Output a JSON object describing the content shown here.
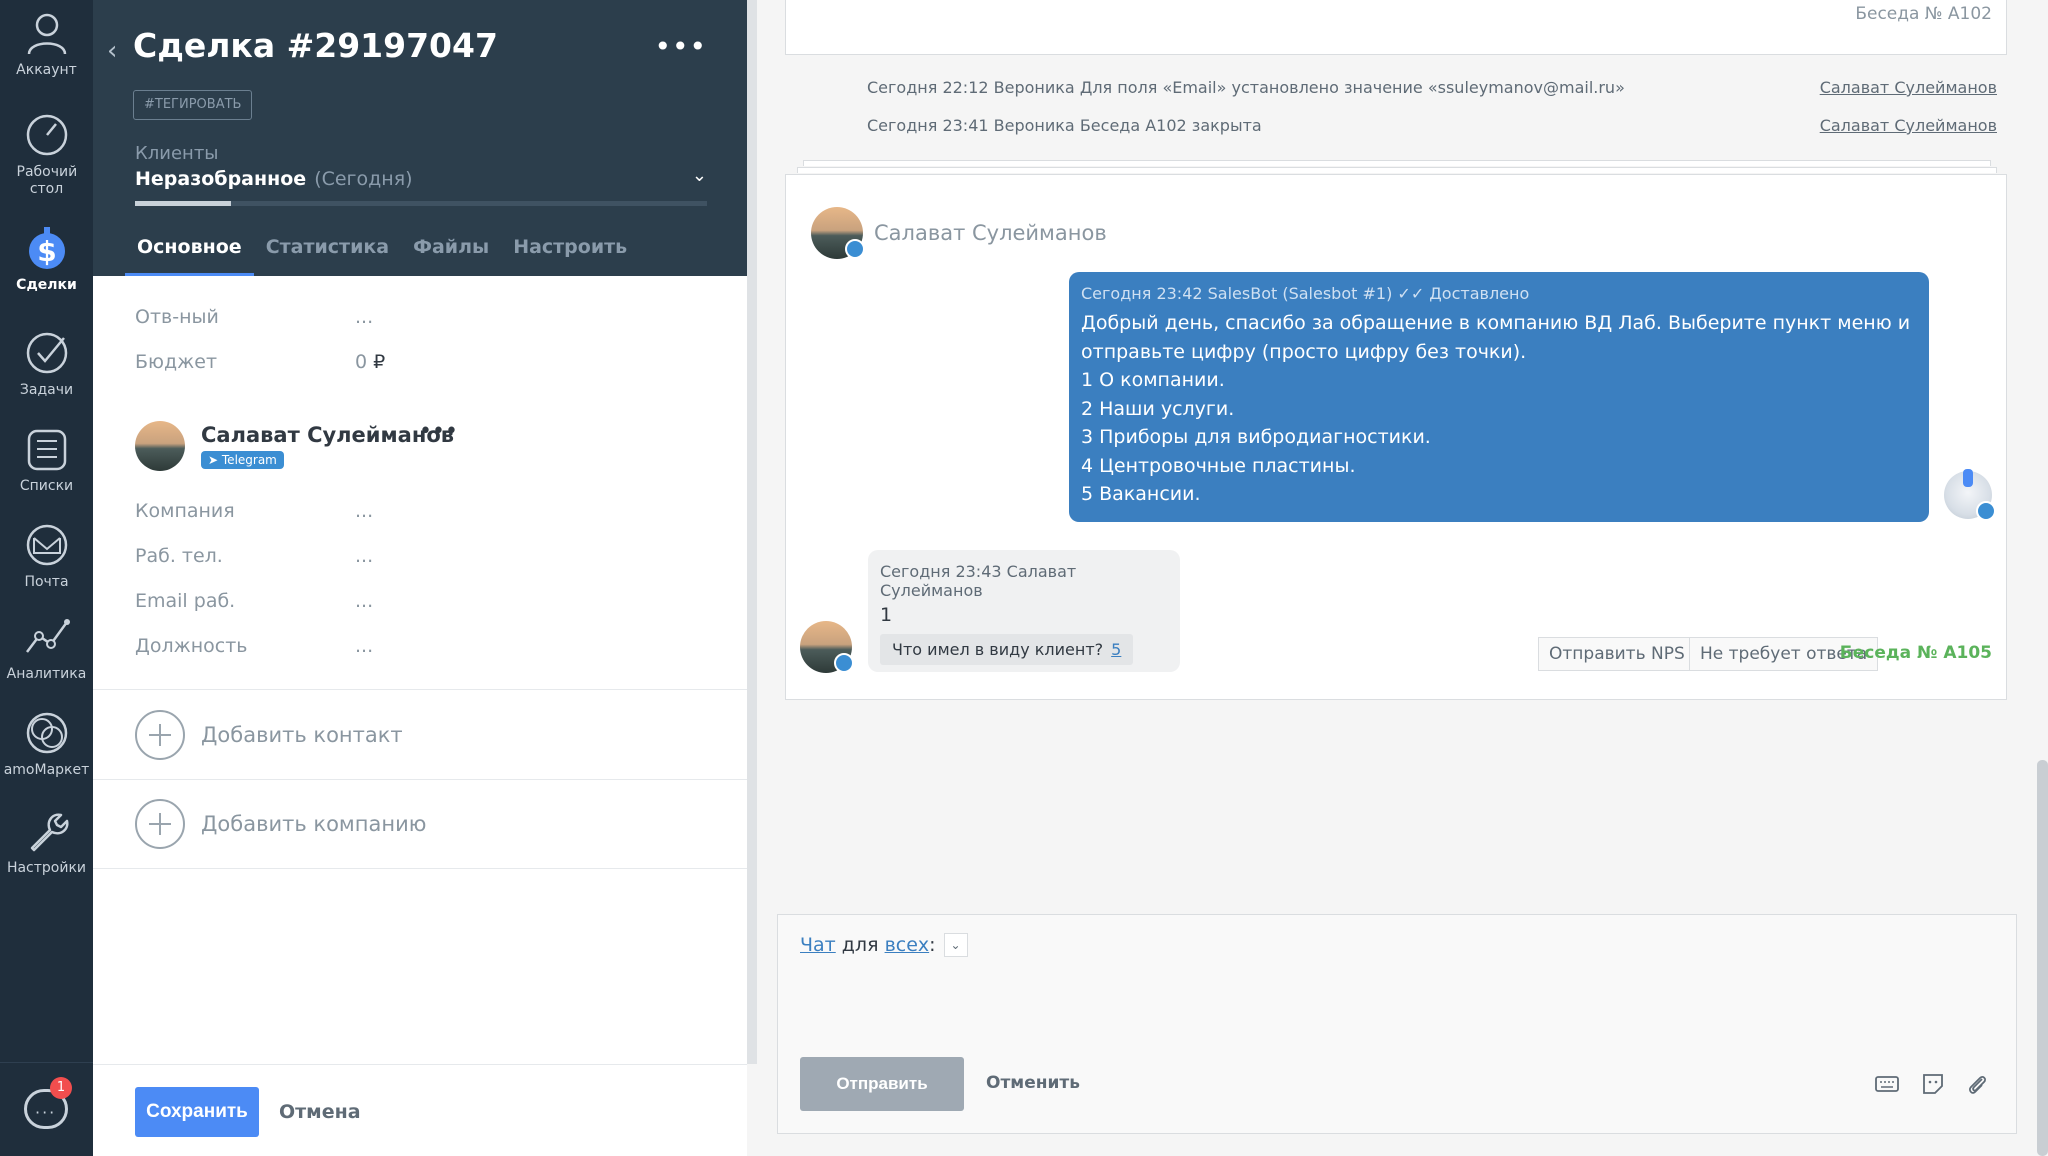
{
  "nav": {
    "items": [
      {
        "label": "Аккаунт"
      },
      {
        "label": "Рабочий стол"
      },
      {
        "label": "Сделки"
      },
      {
        "label": "Задачи"
      },
      {
        "label": "Списки"
      },
      {
        "label": "Почта"
      },
      {
        "label": "Аналитика"
      },
      {
        "label": "amoМаркет"
      },
      {
        "label": "Настройки"
      }
    ],
    "chat_badge": "1"
  },
  "deal": {
    "title": "Сделка #29197047",
    "tag_button": "#ТЕГИРОВАТЬ",
    "pipeline": "Клиенты",
    "stage": "Неразобранное",
    "stage_time": "(Сегодня)",
    "tabs": [
      "Основное",
      "Статистика",
      "Файлы",
      "Настроить"
    ],
    "fields": {
      "responsible_label": "Отв-ный",
      "responsible_value": "...",
      "budget_label": "Бюджет",
      "budget_value": "0",
      "budget_currency": "₽"
    },
    "contact": {
      "name": "Салават Сулейманов",
      "channel": "Telegram",
      "fields": [
        {
          "label": "Компания",
          "value": "..."
        },
        {
          "label": "Раб. тел.",
          "value": "..."
        },
        {
          "label": "Email раб.",
          "value": "..."
        },
        {
          "label": "Должность",
          "value": "..."
        }
      ]
    },
    "add_contact": "Добавить контакт",
    "add_company": "Добавить компанию",
    "save": "Сохранить",
    "cancel": "Отмена"
  },
  "feed": {
    "prev_chat_id": "Беседа № A102",
    "events": [
      {
        "text": "Сегодня 22:12 Вероника Для поля «Email» установлено значение «ssuleymanov@mail.ru»",
        "who": "Салават Сулейманов"
      },
      {
        "text": "Сегодня 23:41 Вероника Беседа A102 закрыта",
        "who": "Салават Сулейманов"
      }
    ],
    "chat": {
      "contact_name": "Салават Сулейманов",
      "bot_message": {
        "meta": "Сегодня 23:42 SalesBot (Salesbot #1)",
        "status": "✓✓ Доставлено",
        "lines": [
          "Добрый день, спасибо за обращение в компанию ВД Лаб. Выберите пункт меню и",
          "отправьте цифру (просто цифру без точки).",
          "1 О компании.",
          "2 Наши услуги.",
          "3 Приборы для вибродиагностики.",
          "4 Центровочные пластины.",
          "5 Вакансии."
        ]
      },
      "user_message": {
        "meta": "Сегодня 23:43 Салават Сулейманов",
        "text": "1",
        "question": "Что имел в виду клиент?",
        "question_link": "5"
      },
      "send_nps": "Отправить NPS",
      "no_reply": "Не требует ответа",
      "chat_id": "Беседа № A105"
    },
    "composer": {
      "mode": "Чат",
      "for": "для",
      "target": "всех",
      "colon": ":",
      "send": "Отправить",
      "undo": "Отменить"
    }
  }
}
